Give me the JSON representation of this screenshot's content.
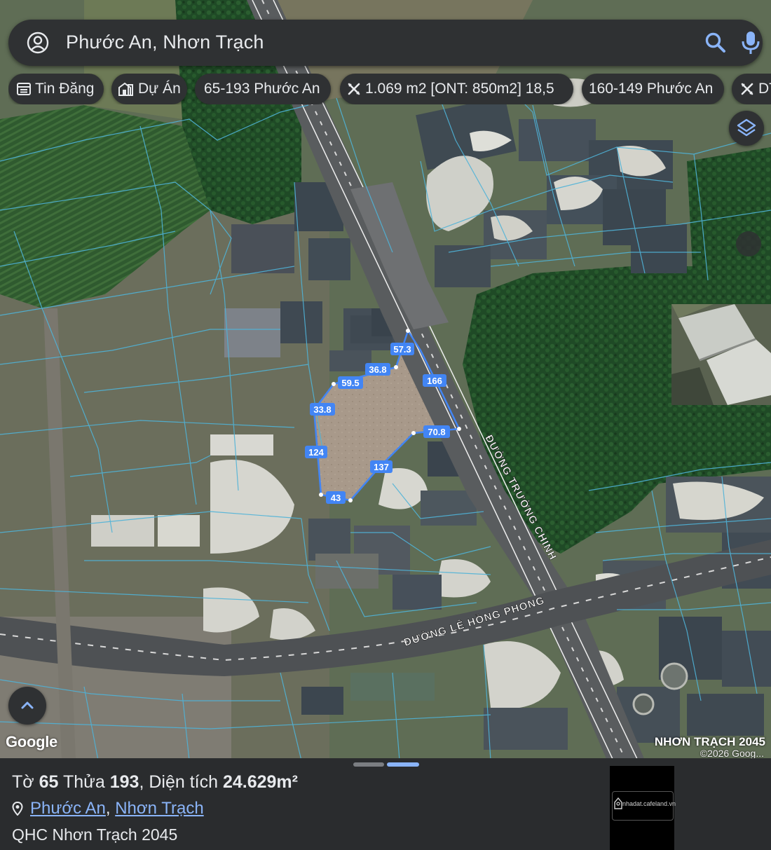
{
  "search": {
    "query": "Phước An, Nhơn Trạch"
  },
  "chips": [
    {
      "label": "Tin Đăng",
      "icon": "list-icon"
    },
    {
      "label": "Dự Án",
      "icon": "building-icon"
    },
    {
      "label": "65-193 Phước An",
      "icon": ""
    },
    {
      "label": "1.069 m2 [ONT: 850m2] 18,5",
      "icon": "ruler-icon"
    },
    {
      "label": "160-149 Phước An",
      "icon": ""
    },
    {
      "label": "DT",
      "icon": "ruler-icon"
    }
  ],
  "map": {
    "parcel_dimensions": [
      "57.3",
      "36.8",
      "59.5",
      "166",
      "33.8",
      "70.8",
      "124",
      "137",
      "43"
    ],
    "road_labels": {
      "truong_chinh": "ĐƯỜNG TRƯỜNG CHINH",
      "le_hong_phong": "ĐƯỜNG LÊ HỒNG PHONG"
    },
    "google_logo": "Google",
    "watermark": "NHƠN TRẠCH 2045",
    "copyright": "©2026 Goog..."
  },
  "sheet": {
    "title_parts": {
      "to_label": "Tờ",
      "to_value": "65",
      "thua_label": "Thửa",
      "thua_value": "193",
      "dt_label": "Diện tích",
      "dt_value": "24.629m²",
      "sep": ","
    },
    "location": {
      "ward": "Phước An",
      "sep": ",",
      "district": "Nhơn Trạch"
    },
    "plan": "QHC Nhơn Trạch 2045",
    "badge": "nhadat.cafeland.vn"
  },
  "colors": {
    "accent": "#8ab4f8",
    "parcel_line": "#4285f4",
    "cadastral": "#4fb3d8",
    "panel": "#2f3133"
  }
}
